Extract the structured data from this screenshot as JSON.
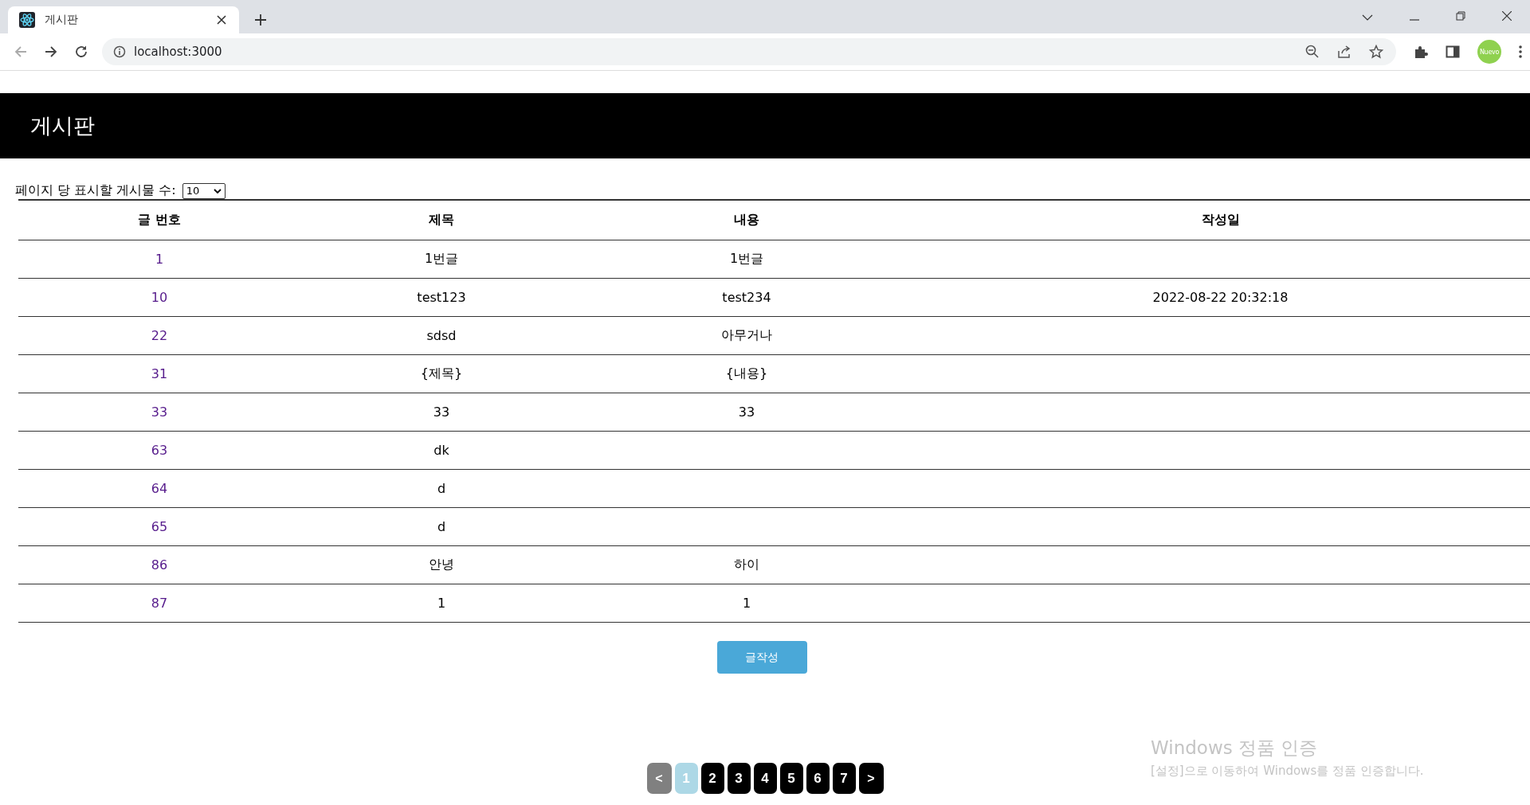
{
  "browser": {
    "tab_title": "게시판",
    "address": "localhost:3000",
    "profile_label": "Nuevo"
  },
  "page": {
    "title": "게시판",
    "per_page_label": "페이지 당 표시할 게시물 수:",
    "per_page_value": "10"
  },
  "table": {
    "columns": [
      "글 번호",
      "제목",
      "내용",
      "작성일"
    ],
    "rows": [
      {
        "cells": [
          "1",
          "1번글",
          "1번글",
          ""
        ]
      },
      {
        "cells": [
          "10",
          "test123",
          "test234",
          "2022-08-22 20:32:18"
        ]
      },
      {
        "cells": [
          "22",
          "sdsd",
          "아무거나",
          ""
        ]
      },
      {
        "cells": [
          "31",
          "{제목}",
          "{내용}",
          ""
        ]
      },
      {
        "cells": [
          "33",
          "33",
          "33",
          ""
        ]
      },
      {
        "cells": [
          "63",
          "dk",
          "",
          ""
        ]
      },
      {
        "cells": [
          "64",
          "d",
          "",
          ""
        ]
      },
      {
        "cells": [
          "65",
          "d",
          "",
          ""
        ]
      },
      {
        "cells": [
          "86",
          "안녕",
          "하이",
          ""
        ]
      },
      {
        "cells": [
          "87",
          "1",
          "1",
          ""
        ]
      }
    ]
  },
  "write_button": "글작성",
  "pagination": [
    {
      "label": "<",
      "kind": "prev",
      "selected": false,
      "disabled": true
    },
    {
      "label": "1",
      "kind": "page",
      "selected": true,
      "disabled": false
    },
    {
      "label": "2",
      "kind": "page",
      "selected": false,
      "disabled": false
    },
    {
      "label": "3",
      "kind": "page",
      "selected": false,
      "disabled": false
    },
    {
      "label": "4",
      "kind": "page",
      "selected": false,
      "disabled": false
    },
    {
      "label": "5",
      "kind": "page",
      "selected": false,
      "disabled": false
    },
    {
      "label": "6",
      "kind": "page",
      "selected": false,
      "disabled": false
    },
    {
      "label": "7",
      "kind": "page",
      "selected": false,
      "disabled": false
    },
    {
      "label": ">",
      "kind": "next",
      "selected": false,
      "disabled": false
    }
  ],
  "activation_notice": {
    "title": "Windows 정품 인증",
    "message": "[설정]으로 이동하여 Windows를 정품 인증합니다."
  }
}
